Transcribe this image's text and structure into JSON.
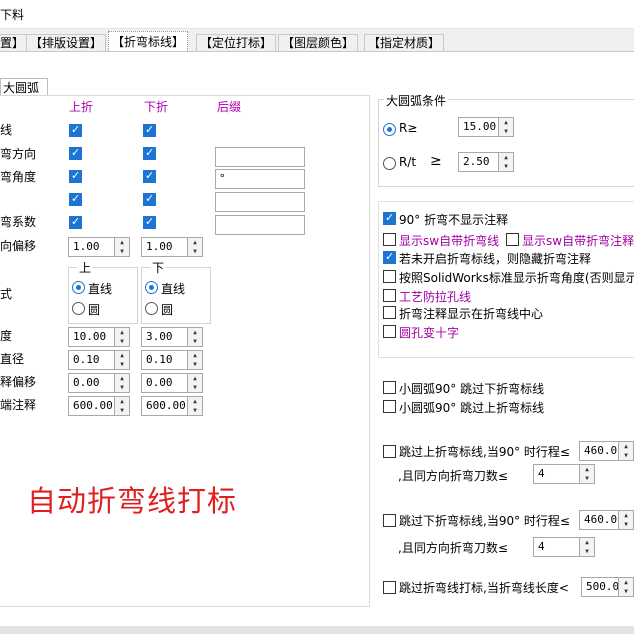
{
  "window": {
    "title_fragment": "下料"
  },
  "tabs": [
    {
      "label": "置】"
    },
    {
      "label": "【排版设置】"
    },
    {
      "label": "【折弯标线】"
    },
    {
      "label": "【定位打标】"
    },
    {
      "label": "【图层颜色】"
    },
    {
      "label": "【指定材质】"
    }
  ],
  "subtab": {
    "label": "大圆弧"
  },
  "left": {
    "col_up": "上折",
    "col_down": "下折",
    "col_suffix": "后缀",
    "rows": [
      {
        "label": "线",
        "up": true,
        "down": true
      },
      {
        "label": "弯方向",
        "up": true,
        "down": true,
        "suffix": ""
      },
      {
        "label": "弯角度",
        "up": true,
        "down": true,
        "suffix": "°"
      },
      {
        "label": "",
        "up": true,
        "down": true,
        "suffix": ""
      },
      {
        "label": "弯系数",
        "up": true,
        "down": true,
        "suffix": ""
      }
    ],
    "offset": {
      "label": "向偏移",
      "up": "1.00",
      "down": "1.00"
    },
    "style": {
      "label": "式",
      "up_title": "上",
      "down_title": "下",
      "line": "直线",
      "circle": "圆",
      "up_selected": "直线",
      "down_selected": "直线"
    },
    "fields": [
      {
        "label": "度",
        "up": "10.00",
        "down": "3.00"
      },
      {
        "label": "直径",
        "up": "0.10",
        "down": "0.10"
      },
      {
        "label": "释偏移",
        "up": "0.00",
        "down": "0.00"
      },
      {
        "label": "端注释",
        "up": "600.00",
        "down": "600.00"
      }
    ],
    "caption": "自动折弯线打标"
  },
  "arc": {
    "title": "大圆弧条件",
    "r_label": "R≥",
    "r_value": "15.00",
    "rt_label": "R/t",
    "rt_cmp": "≥",
    "rt_value": "2.50",
    "selected": "R"
  },
  "options": [
    {
      "label": "90° 折弯不显示注释",
      "checked": true,
      "purple": false
    },
    {
      "label": "显示sw自带折弯线",
      "checked": false,
      "purple": true
    },
    {
      "label": "显示sw自带折弯注释",
      "checked": false,
      "purple": true
    },
    {
      "label": "若未开启折弯标线，则隐藏折弯注释",
      "checked": true,
      "purple": false
    },
    {
      "label": "按照SolidWorks标准显示折弯角度(否则显示",
      "checked": false,
      "purple": false
    },
    {
      "label": "工艺防拉孔线",
      "checked": false,
      "purple": true
    },
    {
      "label": "折弯注释显示在折弯线中心",
      "checked": false,
      "purple": false
    },
    {
      "label": "圆孔变十字",
      "checked": false,
      "purple": true
    }
  ],
  "arc_skip": [
    {
      "label": "小圆弧90° 跳过下折弯标线",
      "checked": false
    },
    {
      "label": "小圆弧90° 跳过上折弯标线",
      "checked": false
    }
  ],
  "skip_down": {
    "label": "跳过上折弯标线,当90° 时行程≤",
    "value": "460.0",
    "sub_label": ",且同方向折弯刀数≤",
    "sub_value": "4"
  },
  "skip_up": {
    "label": "跳过下折弯标线,当90° 时行程≤",
    "value": "460.0",
    "sub_label": ",且同方向折弯刀数≤",
    "sub_value": "4"
  },
  "skip_len": {
    "label": "跳过折弯线打标,当折弯线长度<",
    "value": "500.0"
  }
}
